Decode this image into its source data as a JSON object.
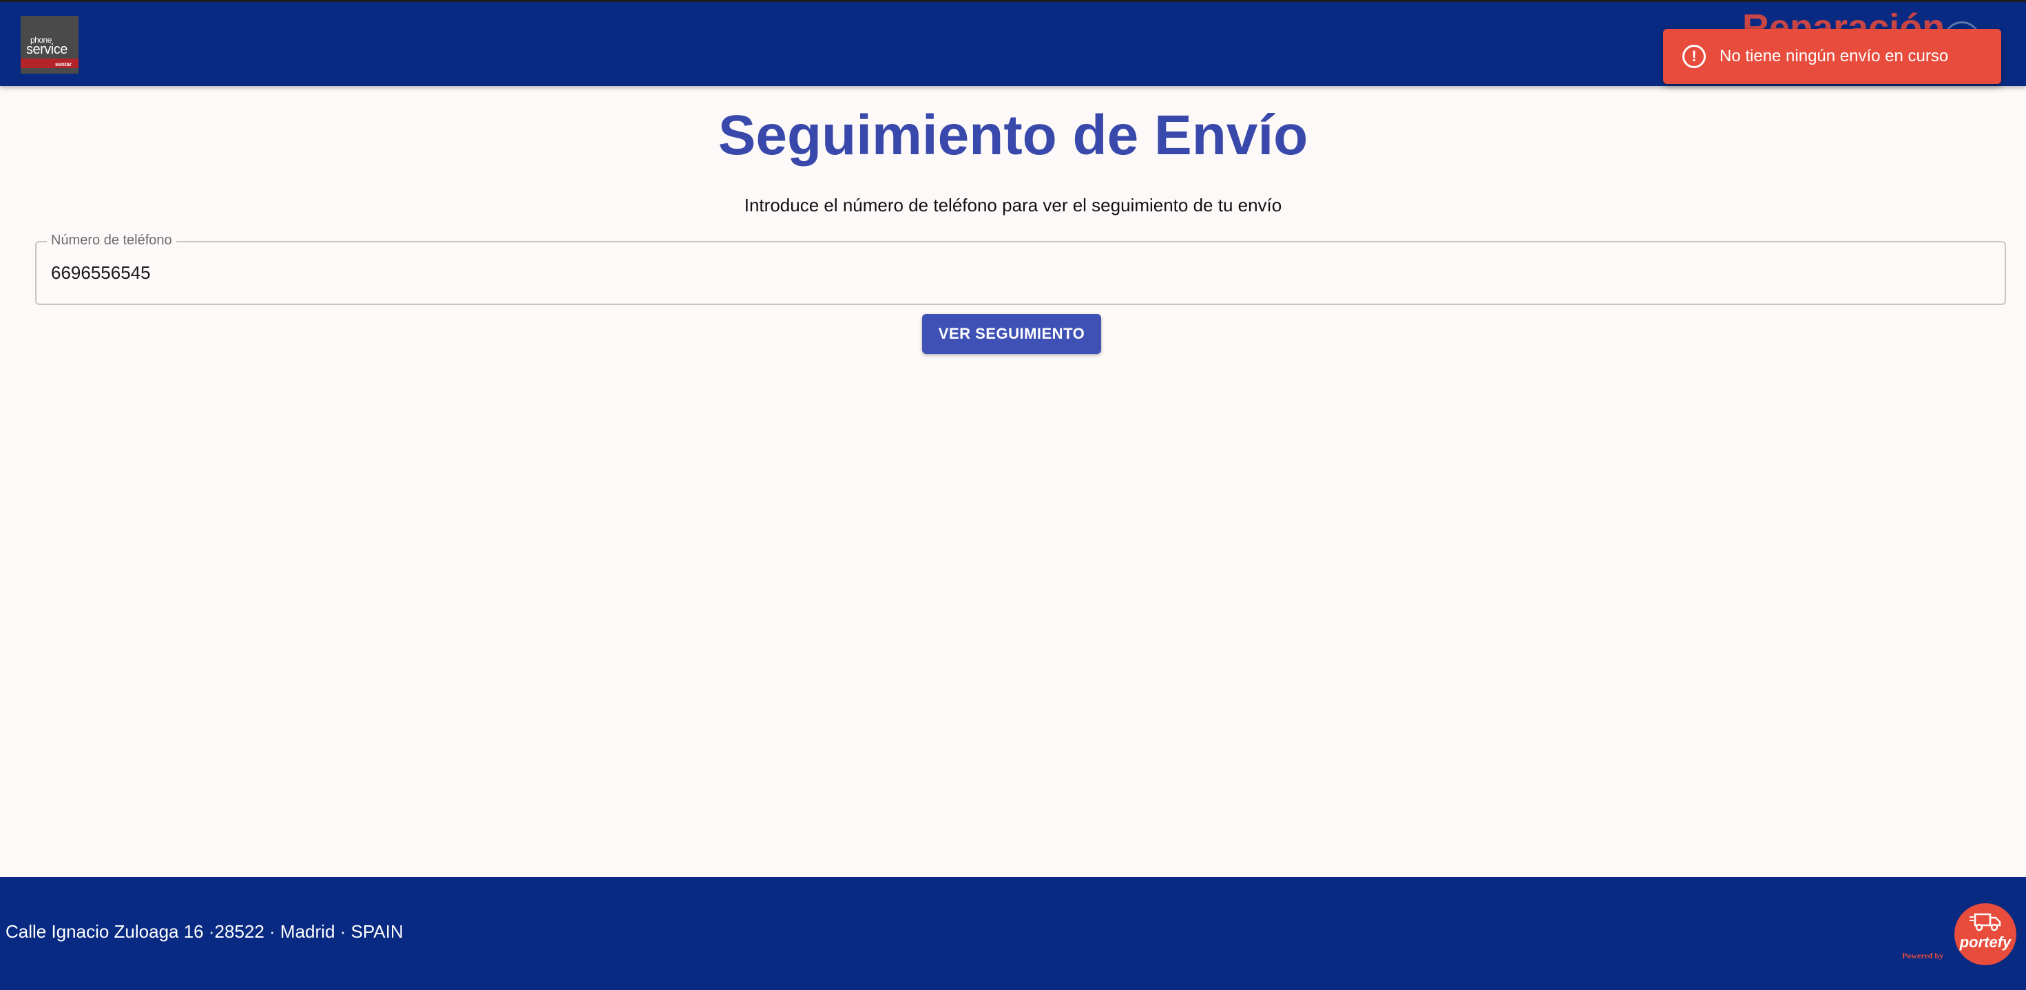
{
  "header": {
    "logo": {
      "line1": "phone",
      "line2": "service",
      "line3": "sentar"
    },
    "ghost_title": "Reparación"
  },
  "toast": {
    "message": "No tiene ningún envío en curso",
    "icon": "alert-circle-icon",
    "close_icon": "close-icon",
    "background": "#e74c3c"
  },
  "main": {
    "title": "Seguimiento de Envío",
    "subtitle": "Introduce el número de teléfono para ver el seguimiento de tu envío",
    "phone_field": {
      "label": "Número de teléfono",
      "value": "6696556545"
    },
    "submit_label": "VER SEGUIMIENTO"
  },
  "footer": {
    "address": "Calle Ignacio Zuloaga 16 ·28522 · Madrid · SPAIN",
    "powered_by": "Powered by",
    "brand": "portefy"
  },
  "colors": {
    "header_bg": "#082a82",
    "accent": "#3f51b5",
    "title": "#3949ab",
    "page_bg": "#fdf9f8"
  }
}
